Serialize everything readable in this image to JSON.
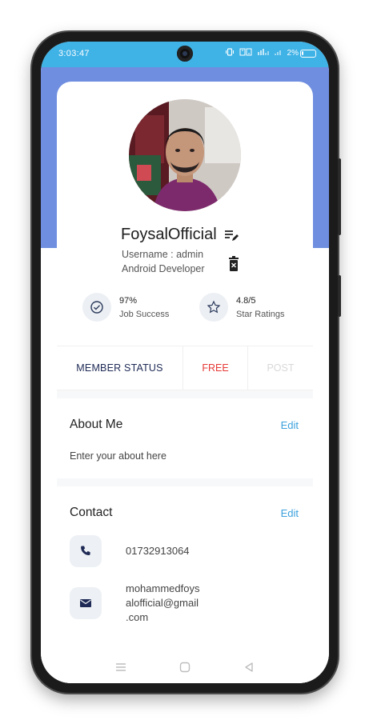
{
  "status_bar": {
    "time": "3:03:47",
    "battery_percent": "2%",
    "battery_level": 0.02
  },
  "profile": {
    "name": "FoysalOfficial",
    "username": "Username : admin",
    "role": "Android Developer"
  },
  "stats": [
    {
      "value": "97%",
      "label": "Job Success",
      "icon": "check-circle-icon"
    },
    {
      "value": "4.8/5",
      "label": "Star Ratings",
      "icon": "star-icon"
    }
  ],
  "membership": {
    "label": "MEMBER STATUS",
    "status": "FREE",
    "action": "POST"
  },
  "about": {
    "title": "About Me",
    "edit_label": "Edit",
    "text": "Enter your about here"
  },
  "contact": {
    "title": "Contact",
    "edit_label": "Edit",
    "phone": "01732913064",
    "email_lines": [
      "mohammedfoys",
      "alofficial@gmail",
      ".com"
    ]
  },
  "colors": {
    "status_bar": "#3fb2e6",
    "header": "#6f8ee0",
    "accent_link": "#3aa0dc",
    "free_status": "#e53935",
    "member_text": "#1e2a55"
  }
}
